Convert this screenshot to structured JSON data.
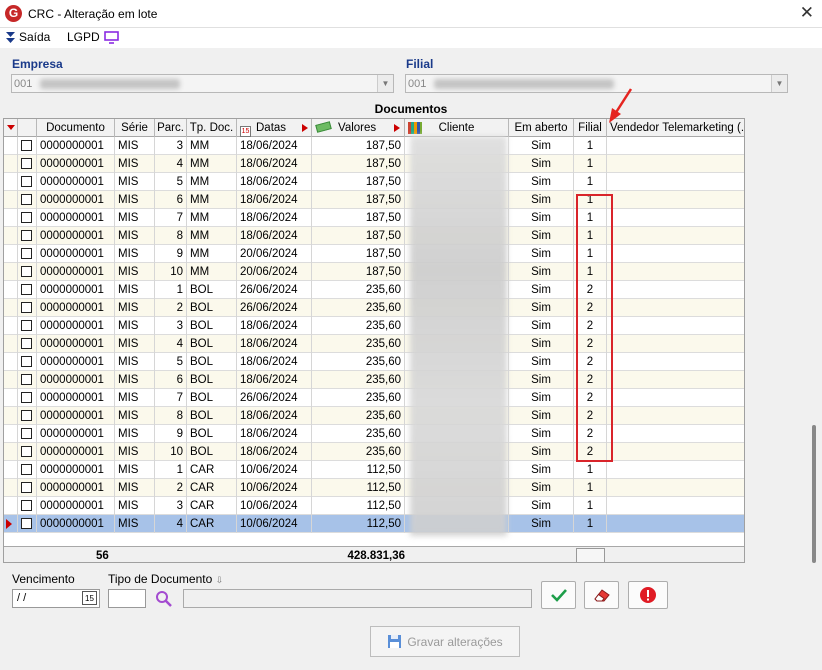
{
  "window": {
    "title": "CRC - Alteração em lote",
    "app_icon_letter": "G"
  },
  "menu": {
    "saida": "Saída",
    "lgpd": "LGPD"
  },
  "empresa": {
    "label": "Empresa",
    "value": "001"
  },
  "filial": {
    "label": "Filial",
    "value": "001"
  },
  "grid": {
    "caption": "Documentos",
    "columns": [
      "Documento",
      "Série",
      "Parc.",
      "Tp. Doc.",
      "Datas",
      "Valores",
      "Cliente",
      "Em aberto",
      "Filial",
      "Vendedor Telemarketing (..."
    ],
    "rows": [
      {
        "documento": "0000000001",
        "serie": "MIS",
        "parc": "3",
        "tpdoc": "MM",
        "data": "18/06/2024",
        "valor": "187,50",
        "aberto": "Sim",
        "filial": "1"
      },
      {
        "documento": "0000000001",
        "serie": "MIS",
        "parc": "4",
        "tpdoc": "MM",
        "data": "18/06/2024",
        "valor": "187,50",
        "aberto": "Sim",
        "filial": "1"
      },
      {
        "documento": "0000000001",
        "serie": "MIS",
        "parc": "5",
        "tpdoc": "MM",
        "data": "18/06/2024",
        "valor": "187,50",
        "aberto": "Sim",
        "filial": "1"
      },
      {
        "documento": "0000000001",
        "serie": "MIS",
        "parc": "6",
        "tpdoc": "MM",
        "data": "18/06/2024",
        "valor": "187,50",
        "aberto": "Sim",
        "filial": "1"
      },
      {
        "documento": "0000000001",
        "serie": "MIS",
        "parc": "7",
        "tpdoc": "MM",
        "data": "18/06/2024",
        "valor": "187,50",
        "aberto": "Sim",
        "filial": "1"
      },
      {
        "documento": "0000000001",
        "serie": "MIS",
        "parc": "8",
        "tpdoc": "MM",
        "data": "18/06/2024",
        "valor": "187,50",
        "aberto": "Sim",
        "filial": "1"
      },
      {
        "documento": "0000000001",
        "serie": "MIS",
        "parc": "9",
        "tpdoc": "MM",
        "data": "20/06/2024",
        "valor": "187,50",
        "aberto": "Sim",
        "filial": "1"
      },
      {
        "documento": "0000000001",
        "serie": "MIS",
        "parc": "10",
        "tpdoc": "MM",
        "data": "20/06/2024",
        "valor": "187,50",
        "aberto": "Sim",
        "filial": "1"
      },
      {
        "documento": "0000000001",
        "serie": "MIS",
        "parc": "1",
        "tpdoc": "BOL",
        "data": "26/06/2024",
        "valor": "235,60",
        "aberto": "Sim",
        "filial": "2"
      },
      {
        "documento": "0000000001",
        "serie": "MIS",
        "parc": "2",
        "tpdoc": "BOL",
        "data": "26/06/2024",
        "valor": "235,60",
        "aberto": "Sim",
        "filial": "2"
      },
      {
        "documento": "0000000001",
        "serie": "MIS",
        "parc": "3",
        "tpdoc": "BOL",
        "data": "18/06/2024",
        "valor": "235,60",
        "aberto": "Sim",
        "filial": "2"
      },
      {
        "documento": "0000000001",
        "serie": "MIS",
        "parc": "4",
        "tpdoc": "BOL",
        "data": "18/06/2024",
        "valor": "235,60",
        "aberto": "Sim",
        "filial": "2"
      },
      {
        "documento": "0000000001",
        "serie": "MIS",
        "parc": "5",
        "tpdoc": "BOL",
        "data": "18/06/2024",
        "valor": "235,60",
        "aberto": "Sim",
        "filial": "2"
      },
      {
        "documento": "0000000001",
        "serie": "MIS",
        "parc": "6",
        "tpdoc": "BOL",
        "data": "18/06/2024",
        "valor": "235,60",
        "aberto": "Sim",
        "filial": "2"
      },
      {
        "documento": "0000000001",
        "serie": "MIS",
        "parc": "7",
        "tpdoc": "BOL",
        "data": "26/06/2024",
        "valor": "235,60",
        "aberto": "Sim",
        "filial": "2"
      },
      {
        "documento": "0000000001",
        "serie": "MIS",
        "parc": "8",
        "tpdoc": "BOL",
        "data": "18/06/2024",
        "valor": "235,60",
        "aberto": "Sim",
        "filial": "2"
      },
      {
        "documento": "0000000001",
        "serie": "MIS",
        "parc": "9",
        "tpdoc": "BOL",
        "data": "18/06/2024",
        "valor": "235,60",
        "aberto": "Sim",
        "filial": "2"
      },
      {
        "documento": "0000000001",
        "serie": "MIS",
        "parc": "10",
        "tpdoc": "BOL",
        "data": "18/06/2024",
        "valor": "235,60",
        "aberto": "Sim",
        "filial": "2"
      },
      {
        "documento": "0000000001",
        "serie": "MIS",
        "parc": "1",
        "tpdoc": "CAR",
        "data": "10/06/2024",
        "valor": "112,50",
        "aberto": "Sim",
        "filial": "1"
      },
      {
        "documento": "0000000001",
        "serie": "MIS",
        "parc": "2",
        "tpdoc": "CAR",
        "data": "10/06/2024",
        "valor": "112,50",
        "aberto": "Sim",
        "filial": "1"
      },
      {
        "documento": "0000000001",
        "serie": "MIS",
        "parc": "3",
        "tpdoc": "CAR",
        "data": "10/06/2024",
        "valor": "112,50",
        "aberto": "Sim",
        "filial": "1"
      },
      {
        "documento": "0000000001",
        "serie": "MIS",
        "parc": "4",
        "tpdoc": "CAR",
        "data": "10/06/2024",
        "valor": "112,50",
        "aberto": "Sim",
        "filial": "1"
      }
    ],
    "selected_row": 21,
    "footer": {
      "count": "56",
      "total": "428.831,36"
    }
  },
  "filters": {
    "vencimento_label": "Vencimento",
    "vencimento_value": " / /",
    "tipo_label": "Tipo de Documento"
  },
  "save_button": "Gravar alterações",
  "colors": {
    "accent": "#1a3a8a",
    "highlight_box": "#d9242a",
    "selected_row": "#a7c2e8"
  }
}
